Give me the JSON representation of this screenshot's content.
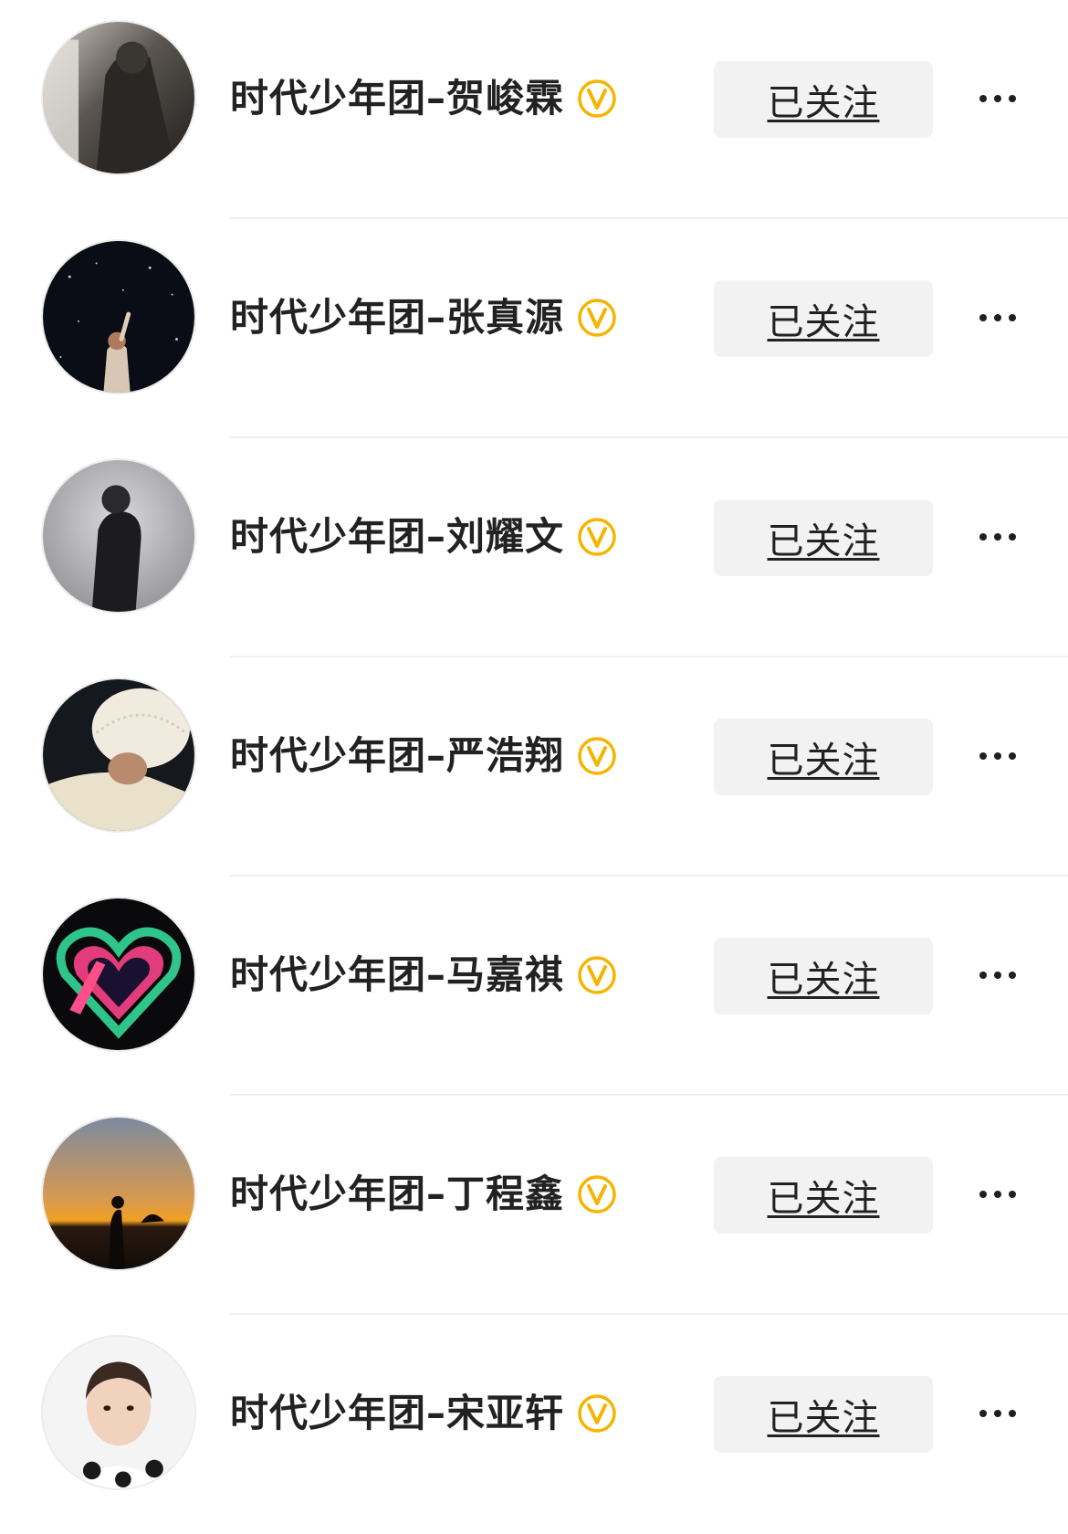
{
  "accounts": [
    {
      "name": "时代少年团–贺峻霖",
      "follow_label": "已关注",
      "verified_icon": "verified-v-icon",
      "avatar_theme": "dark-gray"
    },
    {
      "name": "时代少年团–张真源",
      "follow_label": "已关注",
      "verified_icon": "verified-v-icon",
      "avatar_theme": "night-stars"
    },
    {
      "name": "时代少年团–刘耀文",
      "follow_label": "已关注",
      "verified_icon": "verified-v-icon",
      "avatar_theme": "misty-gray"
    },
    {
      "name": "时代少年团–严浩翔",
      "follow_label": "已关注",
      "verified_icon": "verified-v-icon",
      "avatar_theme": "knit-hat"
    },
    {
      "name": "时代少年团–马嘉祺",
      "follow_label": "已关注",
      "verified_icon": "verified-v-icon",
      "avatar_theme": "neon-heart"
    },
    {
      "name": "时代少年团–丁程鑫",
      "follow_label": "已关注",
      "verified_icon": "verified-v-icon",
      "avatar_theme": "sunset"
    },
    {
      "name": "时代少年团–宋亚轩",
      "follow_label": "已关注",
      "verified_icon": "verified-v-icon",
      "avatar_theme": "portrait-light"
    }
  ],
  "colors": {
    "verified_gold": "#f5b400",
    "button_bg": "#f2f2f3",
    "text": "#222222",
    "divider": "#efefef"
  },
  "more_icon": "more-dots-icon"
}
